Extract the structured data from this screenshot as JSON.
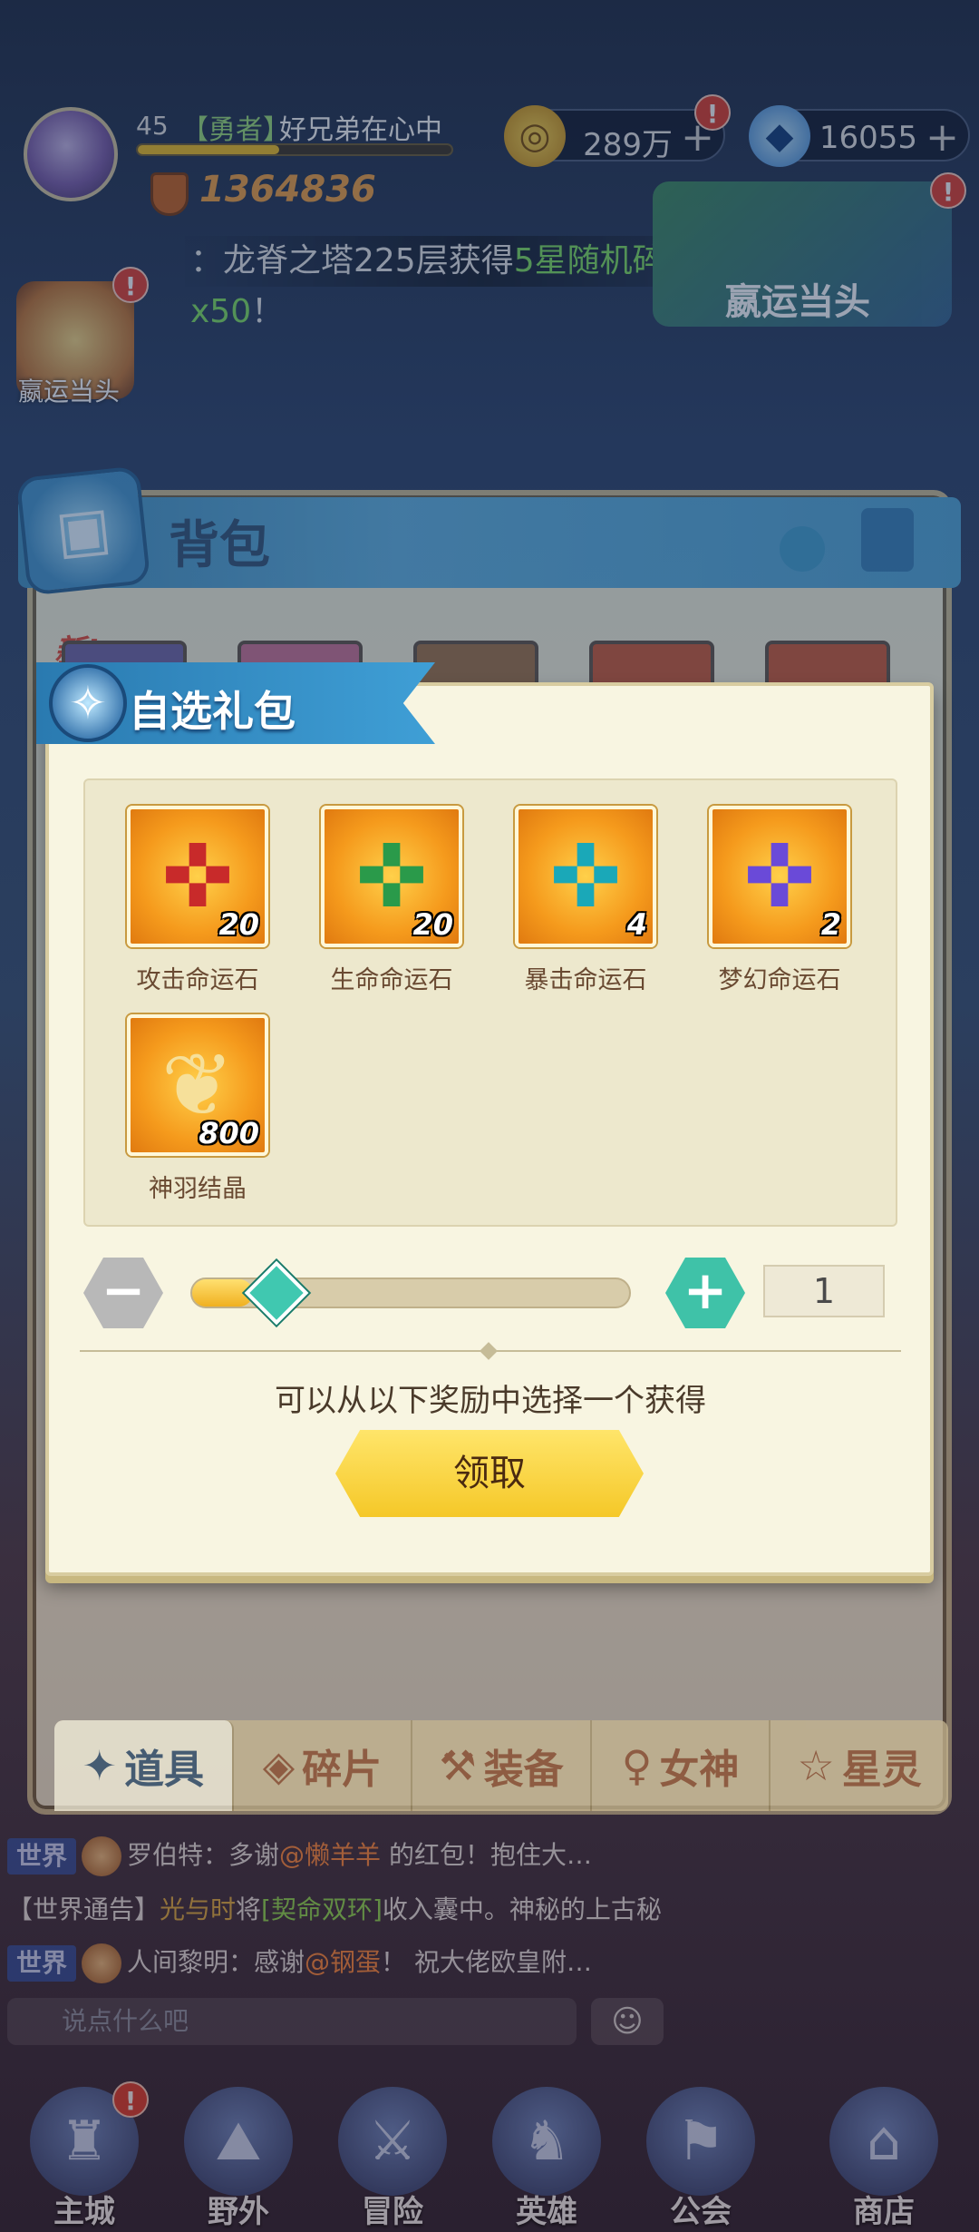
{
  "player": {
    "level": "45",
    "title": "【勇者】",
    "name": "好兄弟在心中",
    "power": "1364836"
  },
  "resources": {
    "gold": "289万",
    "gems": "16055",
    "gold_icon": "gold-coin-icon",
    "gem_icon": "diamond-icon"
  },
  "marquee": {
    "prefix": "：龙脊之塔225层获得",
    "highlight": "5星随机碎片x50",
    "suffix": "！"
  },
  "events": {
    "left_label": "嬴运当头",
    "right_label": "嬴运当头",
    "badge": "!"
  },
  "bag": {
    "title": "背包",
    "new_label": "新!",
    "tabs": [
      {
        "label": "道具",
        "icon": "prop-icon"
      },
      {
        "label": "碎片",
        "icon": "shard-icon"
      },
      {
        "label": "装备",
        "icon": "equipment-icon"
      },
      {
        "label": "女神",
        "icon": "goddess-icon"
      },
      {
        "label": "星灵",
        "icon": "star-spirit-icon"
      }
    ]
  },
  "dialog": {
    "title": "自选礼包",
    "rewards": [
      {
        "name": "攻击命运石",
        "count": "20",
        "icon": "attack-fate-stone-icon"
      },
      {
        "name": "生命命运石",
        "count": "20",
        "icon": "life-fate-stone-icon"
      },
      {
        "name": "暴击命运石",
        "count": "4",
        "icon": "crit-fate-stone-icon"
      },
      {
        "name": "梦幻命运石",
        "count": "2",
        "icon": "dream-fate-stone-icon"
      },
      {
        "name": "神羽结晶",
        "count": "800",
        "icon": "divine-feather-crystal-icon"
      }
    ],
    "quantity": "1",
    "slider_value": 0.14,
    "hint": "可以从以下奖励中选择一个获得",
    "claim_label": "领取"
  },
  "chat": {
    "line1": {
      "channel": "世界",
      "sender": "罗伯特：多谢",
      "mention": "@懒羊羊",
      "text": " 的红包！抱住大…"
    },
    "line2": {
      "prefix": "【世界通告】",
      "player": "光与时",
      "mid": "将",
      "item": "[契命双环]",
      "text": "收入囊中。神秘的上古秘"
    },
    "line3": {
      "channel": "世界",
      "sender": "人间黎明：感谢",
      "mention": "@钢蛋",
      "text": "！ 祝大佬欧皇附…"
    },
    "placeholder": "说点什么吧"
  },
  "nav": [
    {
      "label": "主城",
      "icon": "castle-icon"
    },
    {
      "label": "野外",
      "icon": "wild-icon"
    },
    {
      "label": "冒险",
      "icon": "adventure-icon"
    },
    {
      "label": "英雄",
      "icon": "hero-helmet-icon"
    },
    {
      "label": "公会",
      "icon": "guild-icon"
    },
    {
      "label": "商店",
      "icon": "shop-icon"
    }
  ],
  "colors": {
    "panel": "#f8f5e1",
    "ribbon": "#3f9fd6",
    "claim": "#f5c828",
    "plus": "#3fc2a8"
  }
}
